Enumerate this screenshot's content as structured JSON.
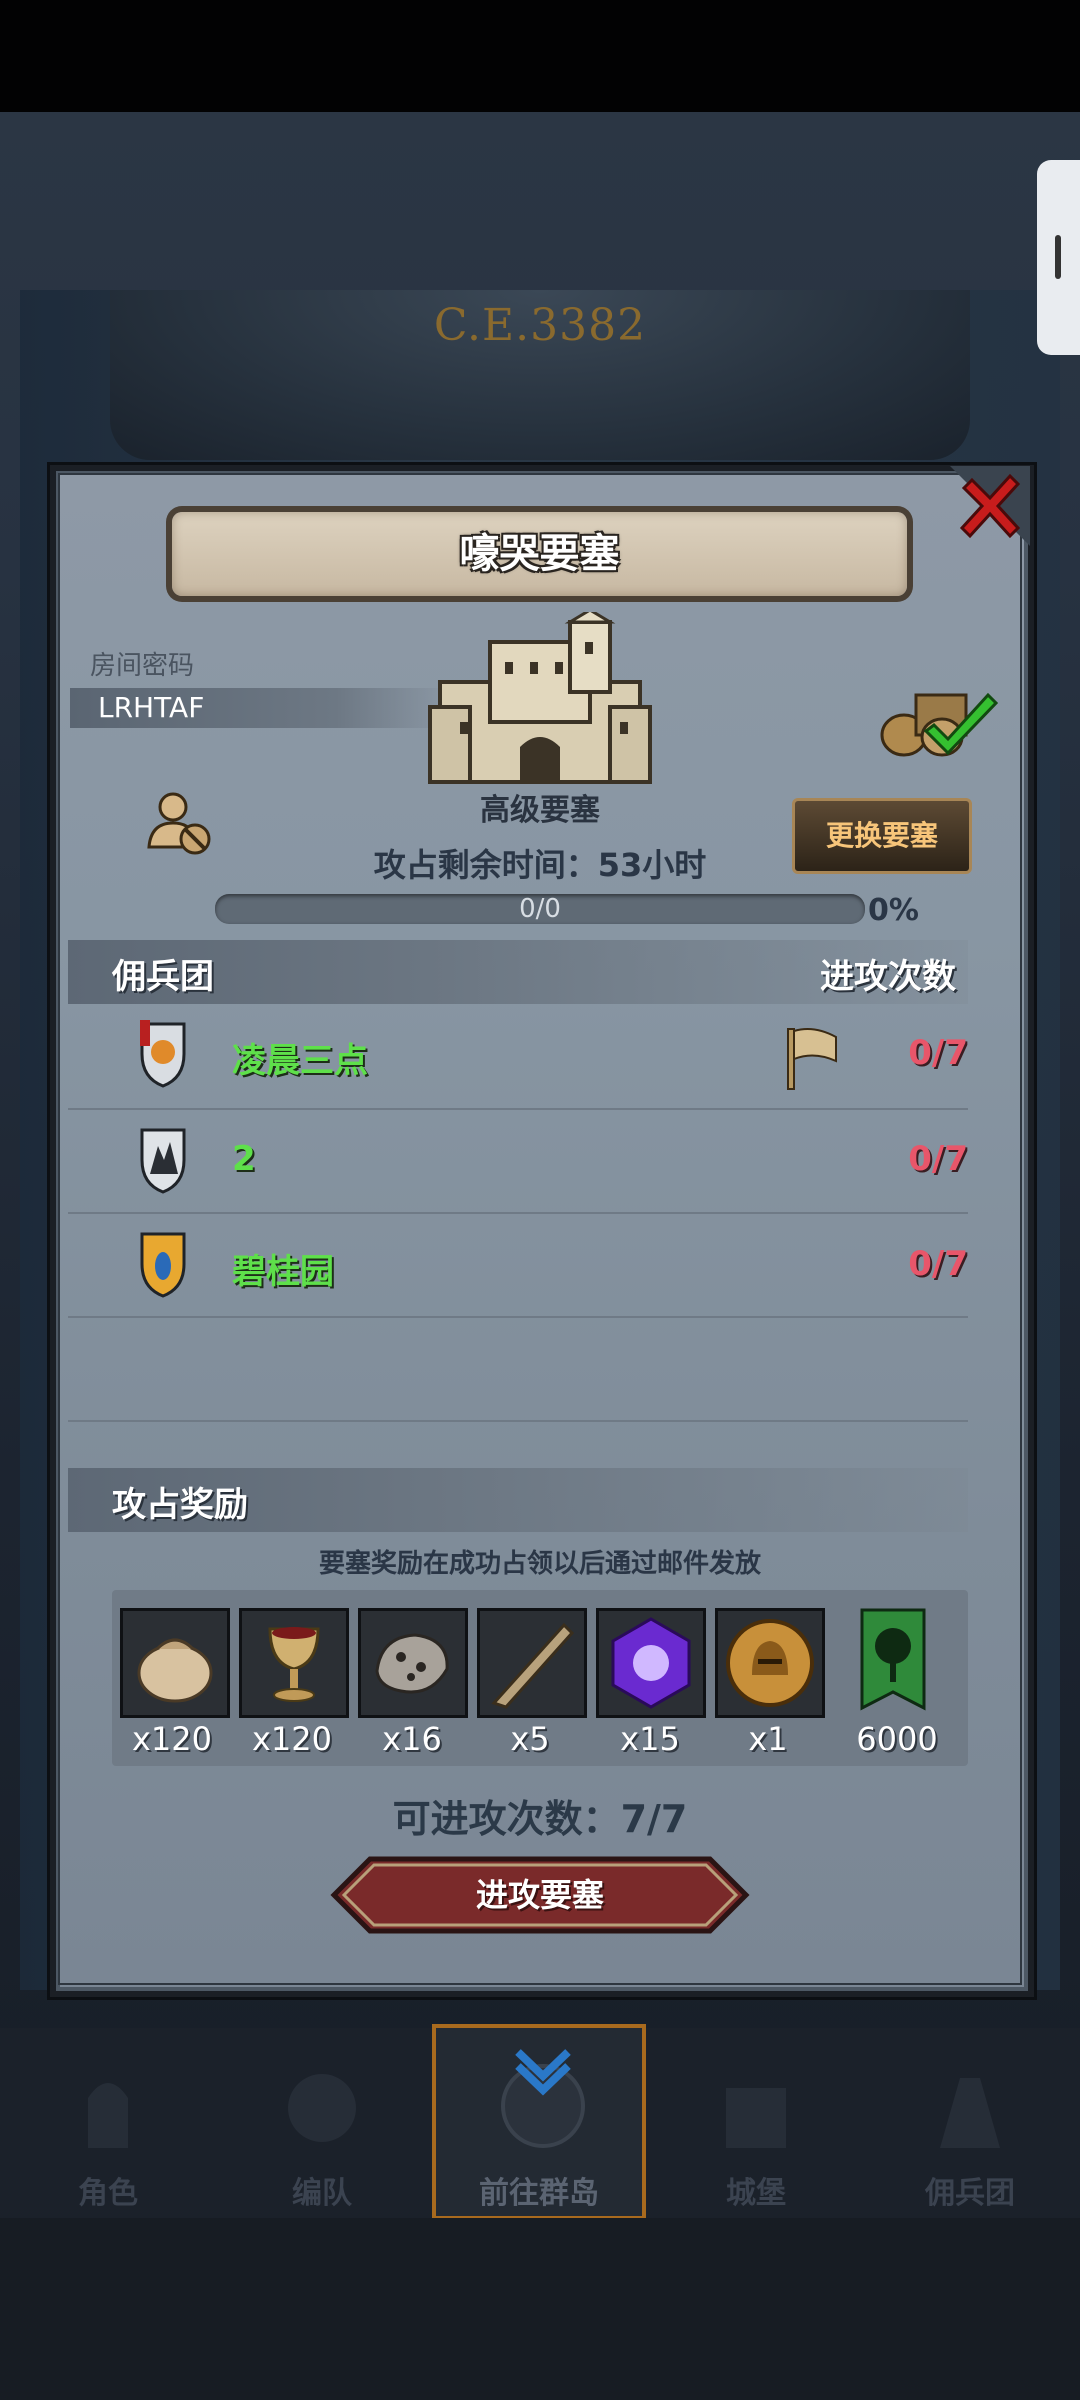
{
  "background": {
    "era_label": "C.E.3382"
  },
  "fortress": {
    "title": "嚎哭要塞",
    "room_label": "房间密码",
    "room_code": "LRHTAF",
    "level": "高级要塞",
    "change_button": "更换要塞",
    "time_left": "攻占剩余时间：53小时",
    "progress_text": "0/0",
    "progress_percent": "0%",
    "progress_fraction": 0
  },
  "mercenaries": {
    "header_left": "佣兵团",
    "header_right": "进攻次数",
    "rows": [
      {
        "name": "凌晨三点",
        "count": "0/7",
        "flag": true,
        "shield": "orange-red"
      },
      {
        "name": "2",
        "count": "0/7",
        "flag": false,
        "shield": "grey"
      },
      {
        "name": "碧桂园",
        "count": "0/7",
        "flag": false,
        "shield": "yellow-blue"
      }
    ]
  },
  "rewards": {
    "header": "攻占奖励",
    "note": "要塞奖励在成功占领以后通过邮件发放",
    "items": [
      {
        "icon": "sack-icon",
        "count": "x120"
      },
      {
        "icon": "goblet-icon",
        "count": "x120"
      },
      {
        "icon": "ore-icon",
        "count": "x16"
      },
      {
        "icon": "horn-icon",
        "count": "x5"
      },
      {
        "icon": "purple-gem-icon",
        "count": "x15"
      },
      {
        "icon": "helmet-coin-icon",
        "count": "x1"
      },
      {
        "icon": "tree-banner-icon",
        "count": "6000"
      }
    ]
  },
  "attacks_left": "可进攻次数：7/7",
  "attack_button": "进攻要塞",
  "nav": [
    "角色",
    "编队",
    "前往群岛",
    "城堡",
    "佣兵团"
  ],
  "colors": {
    "accent": "#c89a4a",
    "name_green": "#5ee04a",
    "count_red": "#e8566a"
  }
}
